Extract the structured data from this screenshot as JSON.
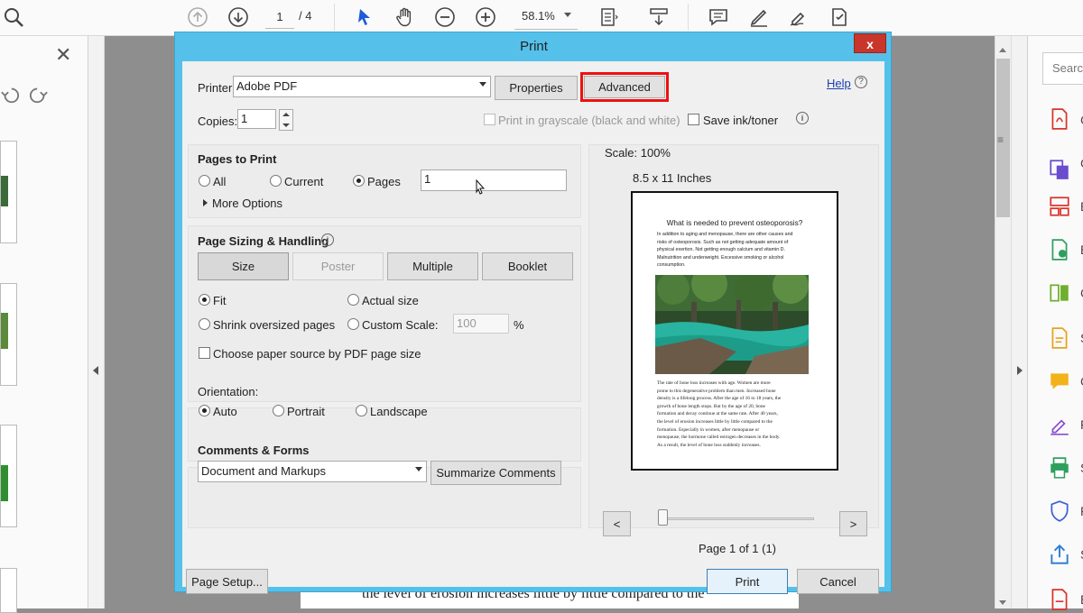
{
  "toolbar": {
    "page_current": "1",
    "page_total": "/ 4",
    "zoom": "58.1%"
  },
  "right_panel": {
    "search_placeholder": "Searc",
    "tool_letters": [
      "C",
      "C",
      "E",
      "E",
      "C",
      "S",
      "C",
      "F",
      "S",
      "P",
      "S",
      "E"
    ]
  },
  "document": {
    "background_line": "the level of erosion increases little by little compared to the"
  },
  "dialog": {
    "title": "Print",
    "close": "x",
    "printer_label": "Printer:",
    "printer_value": "Adobe PDF",
    "properties_button": "Properties",
    "advanced_button": "Advanced",
    "help_link": "Help",
    "copies_label": "Copies:",
    "copies_value": "1",
    "grayscale_label": "Print in grayscale (black and white)",
    "save_ink_label": "Save ink/toner",
    "pages_to_print": {
      "heading": "Pages to Print",
      "all": "All",
      "current": "Current",
      "pages": "Pages",
      "pages_value": "1",
      "more_options": "More Options"
    },
    "sizing": {
      "heading": "Page Sizing & Handling",
      "tabs": [
        "Size",
        "Poster",
        "Multiple",
        "Booklet"
      ],
      "fit": "Fit",
      "actual_size": "Actual size",
      "shrink": "Shrink oversized pages",
      "custom_scale": "Custom Scale:",
      "custom_scale_value": "100",
      "percent": "%",
      "paper_source": "Choose paper source by PDF page size"
    },
    "orientation": {
      "heading": "Orientation:",
      "auto": "Auto",
      "portrait": "Portrait",
      "landscape": "Landscape"
    },
    "comments": {
      "heading": "Comments & Forms",
      "value": "Document and Markups",
      "summarize": "Summarize Comments"
    },
    "preview": {
      "scale": "Scale: 100%",
      "size": "8.5 x 11 Inches",
      "prev": "<",
      "next": ">",
      "page_status": "Page 1 of 1 (1)",
      "page_title": "What is needed to prevent osteoporosis?",
      "para1": [
        "In addition to aging and menopause, there are other causes and",
        "risks of osteoporosis. Such as not getting adequate amount of",
        "physical exertion. Not getting enough calcium and vitamin D.",
        "Malnutrition and underweight. Excessive smoking or alcohol",
        "consumption."
      ],
      "para2": [
        "The rate of bone loss increases with age. Women are more",
        "prone to this degenerative problem than men. Increased bone",
        "density is a lifelong process. After the age of 16 to 18 years, the",
        "growth of bone length stops. But by the age of 20, bone",
        "formation and decay continue at the same rate. After 40 years,",
        "the level of erosion increases little by little compared to the",
        "formation. Especially in women, after menopause or",
        "menopause, the hormone called estrogen decreases in the body.",
        "As a result, the level of bone loss suddenly increases."
      ]
    },
    "page_setup_button": "Page Setup...",
    "print_button": "Print",
    "cancel_button": "Cancel"
  }
}
